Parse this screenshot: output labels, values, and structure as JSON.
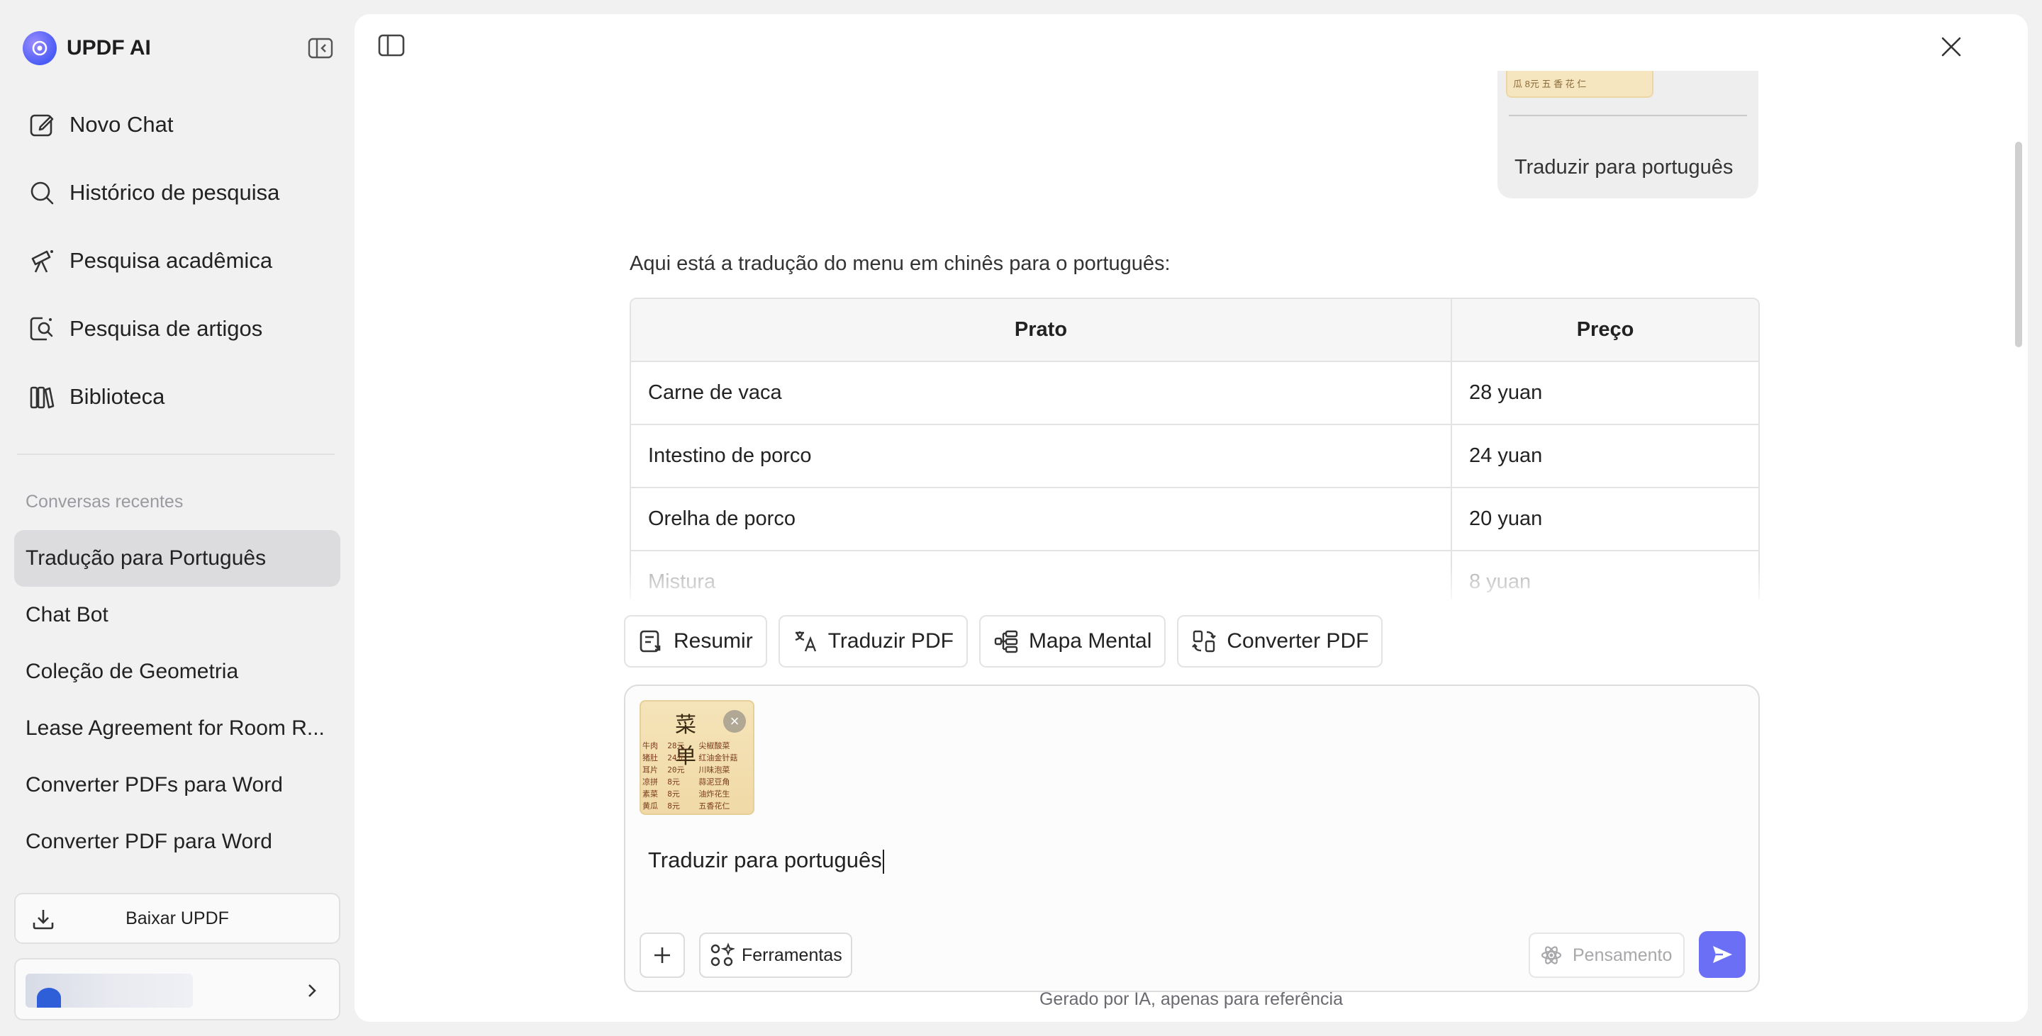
{
  "app": {
    "name": "UPDF AI"
  },
  "sidebar": {
    "nav": [
      {
        "label": "Novo Chat",
        "icon": "edit-icon"
      },
      {
        "label": "Histórico de pesquisa",
        "icon": "search-icon"
      },
      {
        "label": "Pesquisa acadêmica",
        "icon": "telescope-icon"
      },
      {
        "label": "Pesquisa de artigos",
        "icon": "doc-search-icon"
      },
      {
        "label": "Biblioteca",
        "icon": "library-icon"
      }
    ],
    "recent_title": "Conversas recentes",
    "recent": [
      "Tradução para Português",
      "Chat Bot",
      "Coleção de Geometria",
      "Lease Agreement for Room R...",
      "Converter PDFs para Word",
      "Converter PDF para Word"
    ],
    "download_label": "Baixar UPDF"
  },
  "chat": {
    "user_message": "Traduzir para português",
    "thumb_strip": "瓜   8元      五 香 花 仁",
    "answer_intro": "Aqui está a tradução do menu em chinês para o português:",
    "table": {
      "headers": [
        "Prato",
        "Preço"
      ],
      "rows": [
        [
          "Carne de vaca",
          "28 yuan"
        ],
        [
          "Intestino de porco",
          "24 yuan"
        ],
        [
          "Orelha de porco",
          "20 yuan"
        ],
        [
          "Mistura",
          "8 yuan"
        ]
      ]
    }
  },
  "quick_tools": [
    "Resumir",
    "Traduzir PDF",
    "Mapa Mental",
    "Converter PDF"
  ],
  "composer": {
    "attachment_title": "菜 单",
    "attachment_rows": "牛肉  28元   尖椒酸菜\n猪肚  24元   红油金针菇\n耳片  20元   川味泡菜\n凉拼  8元    蒜泥豆角\n素菜  8元    油炸花生\n黄瓜  8元    五香花仁",
    "input_value": "Traduzir para português",
    "tools_label": "Ferramentas",
    "thinking_label": "Pensamento"
  },
  "footnote": "Gerado por IA, apenas para referência",
  "colors": {
    "accent": "#6b6ff5",
    "active_item": "#dcdcdf"
  }
}
